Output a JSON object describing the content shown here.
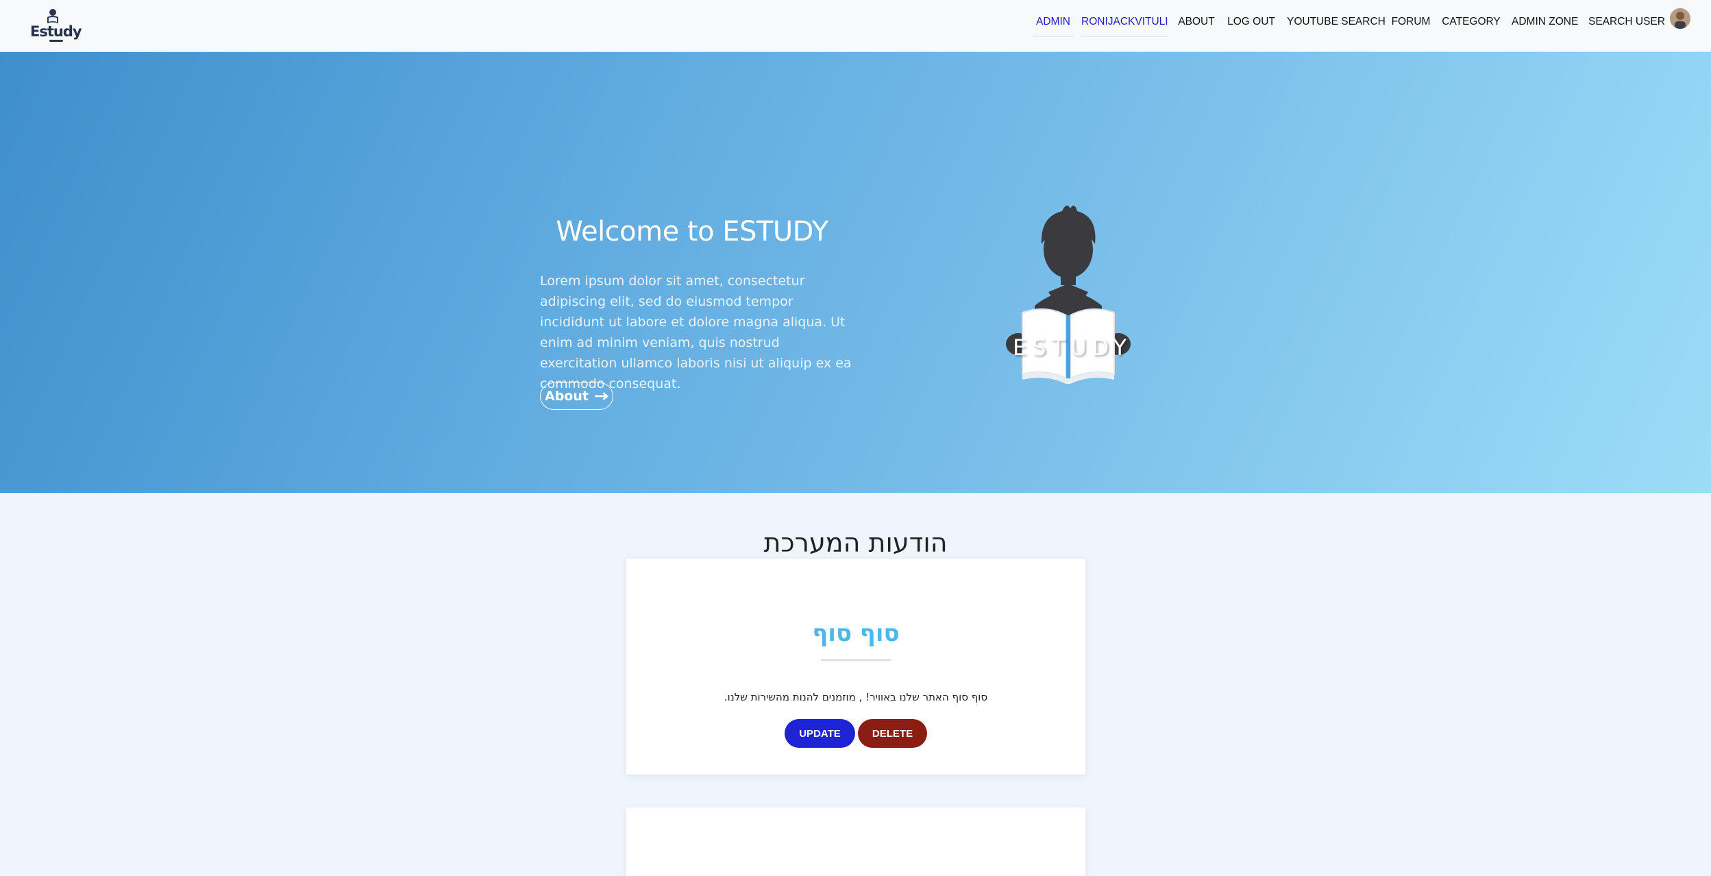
{
  "navbar": {
    "brand": "Estudy",
    "links": [
      {
        "label": "ADMIN",
        "active": true
      },
      {
        "label": "RONIJACKVITULI",
        "active": true
      },
      {
        "label": "ABOUT",
        "active": false
      },
      {
        "label": "LOG OUT",
        "active": false
      },
      {
        "label": "YOUTUBE SEARCH",
        "active": false
      },
      {
        "label": "FORUM",
        "active": false
      },
      {
        "label": "CATEGORY",
        "active": false
      },
      {
        "label": "ADMIN ZONE",
        "active": false
      },
      {
        "label": "SEARCH USER",
        "active": false
      }
    ],
    "active_color": "#1c1dc9"
  },
  "hero": {
    "title": "Welcome to ESTUDY",
    "text": "Lorem ipsum dolor sit amet, consectetur adipiscing elit, sed do eiusmod tempor incididunt ut labore et dolore magna aliqua. Ut enim ad minim veniam, quis nostrud exercitation ullamco laboris nisi ut aliquip ex ea commodo consequat.",
    "button_label": "About",
    "button_icon": "arrow-right-icon",
    "logo_text": "ESTUDY"
  },
  "messages": {
    "title": "הודעות המערכת",
    "items": [
      {
        "title": "סוף סוף",
        "body": "סוף סוף האתר שלנו באוויר! , מוזמנים להנות מהשירות שלנו.",
        "update_label": "UPDATE",
        "delete_label": "DELETE"
      }
    ]
  },
  "colors": {
    "update": "#1e24d4",
    "delete": "#8c1d13",
    "card_title": "#4fb6ea"
  }
}
